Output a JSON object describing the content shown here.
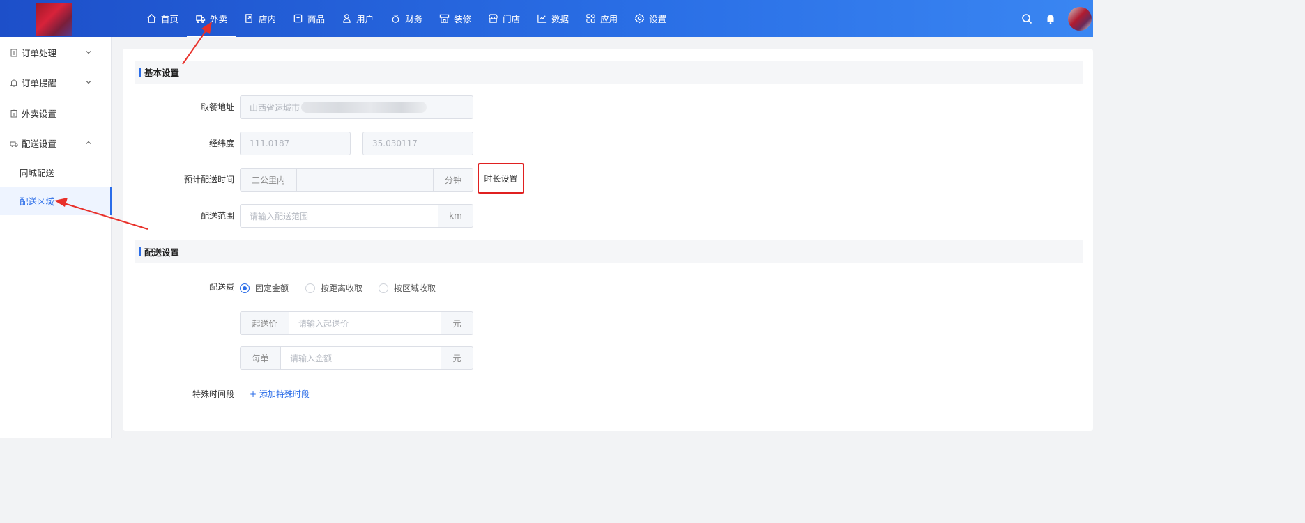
{
  "topnav": {
    "items": [
      {
        "label": "首页",
        "icon": "home-icon"
      },
      {
        "label": "外卖",
        "icon": "takeout-icon",
        "active": true
      },
      {
        "label": "店内",
        "icon": "store-inside-icon"
      },
      {
        "label": "商品",
        "icon": "goods-icon"
      },
      {
        "label": "用户",
        "icon": "user-icon"
      },
      {
        "label": "财务",
        "icon": "finance-icon"
      },
      {
        "label": "装修",
        "icon": "decorate-icon"
      },
      {
        "label": "门店",
        "icon": "shop-icon"
      },
      {
        "label": "数据",
        "icon": "chart-icon"
      },
      {
        "label": "应用",
        "icon": "apps-icon"
      },
      {
        "label": "设置",
        "icon": "gear-icon"
      }
    ]
  },
  "sidebar": {
    "order_processing": "订单处理",
    "order_reminder": "订单提醒",
    "takeout_settings": "外卖设置",
    "delivery_settings": "配送设置",
    "city_delivery": "同城配送",
    "delivery_area": "配送区域"
  },
  "basic": {
    "section_title": "基本设置",
    "pickup_label": "取餐地址",
    "pickup_value": "山西省运城市",
    "coords_label": "经纬度",
    "longitude": "111.0187",
    "latitude": "35.030117",
    "eta_label": "预计配送时间",
    "eta_prefix": "三公里内",
    "eta_unit": "分钟",
    "duration_button": "时长设置",
    "range_label": "配送范围",
    "range_placeholder": "请输入配送范围",
    "range_unit": "km"
  },
  "delivery": {
    "section_title": "配送设置",
    "fee_label": "配送费",
    "options": [
      "固定金额",
      "按距离收取",
      "按区域收取"
    ],
    "selected_option": "固定金额",
    "min_price_prefix": "起送价",
    "min_price_placeholder": "请输入起送价",
    "min_price_unit": "元",
    "per_order_prefix": "每单",
    "per_order_placeholder": "请输入金额",
    "per_order_unit": "元",
    "special_label": "特殊时间段",
    "add_special": "+ 添加特殊时段"
  },
  "colors": {
    "primary": "#2b6de8",
    "topbar": "#2a6fe6",
    "highlight_border": "#e02020",
    "annotation_arrow": "#e8302a"
  }
}
